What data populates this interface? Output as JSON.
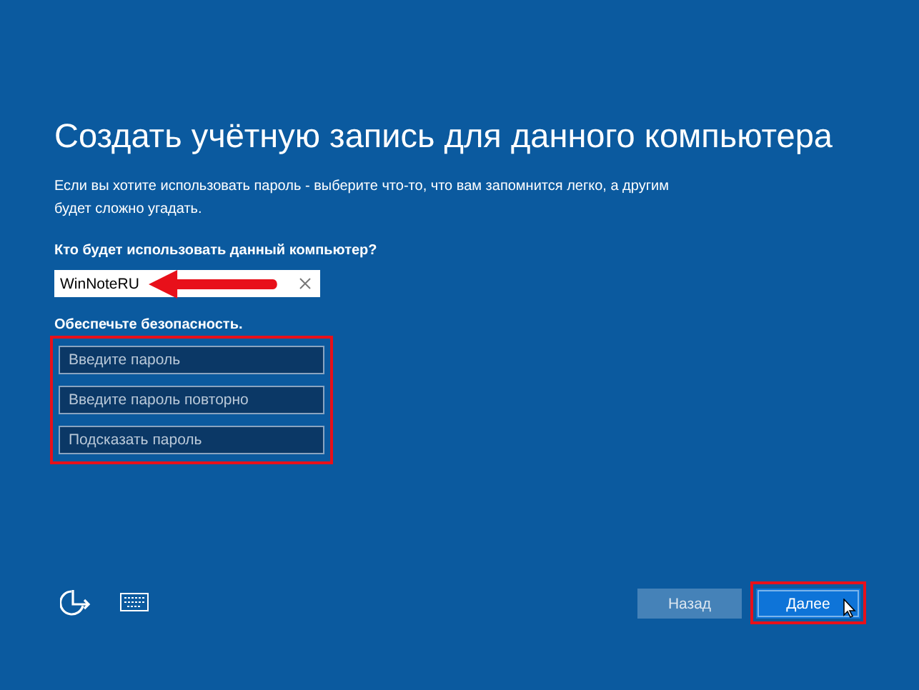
{
  "title": "Создать учётную запись для данного компьютера",
  "description": "Если вы хотите использовать пароль - выберите что-то, что вам запомнится легко, а другим будет сложно угадать.",
  "name_label": "Кто будет использовать данный компьютер?",
  "name_field": {
    "value": "WinNoteRU",
    "highlighted": true
  },
  "security_label": "Обеспечьте безопасность.",
  "password_group": {
    "highlighted": true,
    "fields": [
      {
        "placeholder": "Введите пароль"
      },
      {
        "placeholder": "Введите пароль повторно"
      },
      {
        "placeholder": "Подсказать пароль"
      }
    ]
  },
  "buttons": [
    {
      "label": "Назад",
      "kind": "secondary",
      "highlighted": false
    },
    {
      "label": "Далее",
      "kind": "primary",
      "highlighted": true
    }
  ]
}
